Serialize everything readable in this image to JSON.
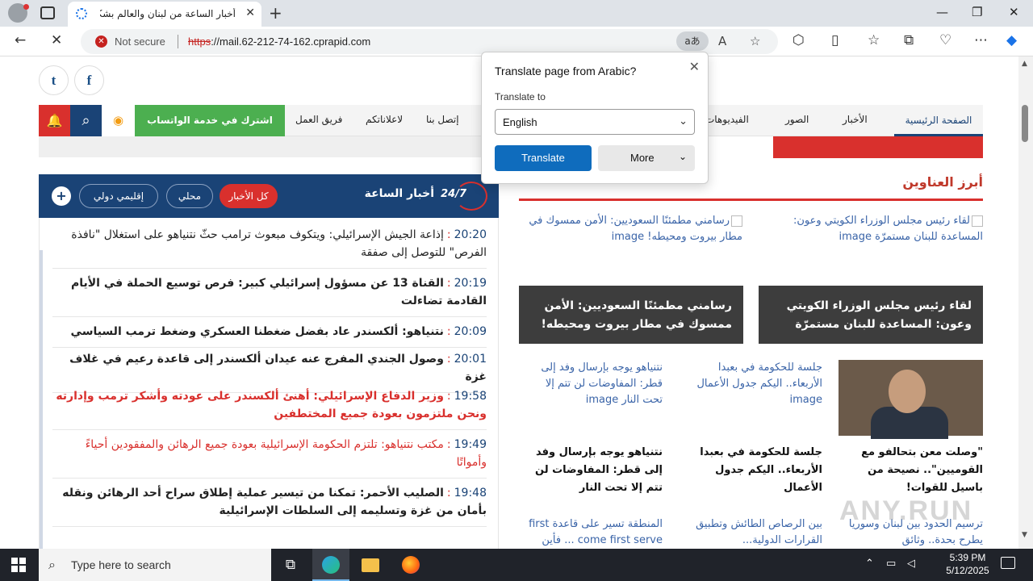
{
  "browser": {
    "tab_title": "أخبار الساعة من لبنان والعالم بشكل",
    "not_secure": "Not secure",
    "url_scheme": "https",
    "url_rest": "://mail.62-212-74-162.cprapid.com",
    "translate_icon": "aあ",
    "window_controls": [
      "—",
      "❐",
      "✕"
    ]
  },
  "translate_popup": {
    "title": "Translate page from Arabic?",
    "translate_to_label": "Translate to",
    "selected_language": "English",
    "translate_button": "Translate",
    "more_button": "More"
  },
  "site": {
    "social": [
      "t",
      "f"
    ],
    "nav": {
      "whatsapp": "اشترك في خدمة الواتساب",
      "items": [
        "فريق العمل",
        "لاعلاناتكم",
        "إتصل بنا",
        "الفيديوهات",
        "الصور",
        "الأخبار"
      ],
      "active": "الصفحة الرئيسية"
    },
    "live": {
      "title": "أخبار الساعة",
      "badge": "24/7",
      "filters": [
        "كل الأخبار",
        "محلي",
        "إقليمي دولي"
      ],
      "active_filter": "كل الأخبار"
    },
    "news": [
      {
        "time": "20:20",
        "text": "إذاعة الجيش الإسرائيلي: ويتكوف مبعوث ترامب حثّ نتنياهو على استغلال \"نافذة الفرص\" للتوصل إلى صفقة",
        "style": "normal"
      },
      {
        "time": "20:19",
        "text": "القناة 13 عن مسؤول إسرائيلي كبير: فرص توسيع الحملة في الأيام القادمة تضاءلت",
        "style": "bold"
      },
      {
        "time": "20:09",
        "text": "نتنياهو: ألكسندر عاد بفضل ضغطنا العسكري وضغط ترمب السياسي",
        "style": "bold"
      },
      {
        "time": "20:01",
        "text": "وصول الجندي المفرج عنه عيدان ألكسندر إلى قاعدة رعيم في غلاف غزة",
        "style": "bold"
      },
      {
        "time": "19:58",
        "text": "وزير الدفاع الإسرائيلي: أهنئ ألكسندر على عودته وأشكر ترمب وإدارته ونحن ملتزمون بعودة جميع المختطفين",
        "style": "red-bold"
      },
      {
        "time": "19:49",
        "text": "مكتب نتنياهو: تلتزم الحكومة الإسرائيلية بعودة جميع الرهائن والمفقودين أحياءً وأمواتًا",
        "style": "red"
      },
      {
        "time": "19:48",
        "text": "الصليب الأحمر: تمكنا من تيسير عملية إطلاق سراح أحد الرهائن ونقله بأمان من غزة وتسليمه إلى السلطات الإسرائيلية",
        "style": "bold"
      }
    ],
    "headlines_title": "أبرز العناوين",
    "headlines": [
      {
        "alt": "لقاء رئيس مجلس الوزراء الكويتي وعون: المساعدة للبنان مستمرّة image",
        "overlay": "لقاء رئيس مجلس الوزراء الكويتي وعون: المساعدة للبنان مستمرّة"
      },
      {
        "alt": "رسامني مطمئنًا السعوديين: الأمن ممسوك في مطار بيروت ومحيطه! image",
        "overlay": "رسامني مطمئنًا السعوديين: الأمن ممسوك في مطار بيروت ومحيطه!"
      }
    ],
    "small_cards": [
      {
        "alt": "",
        "title": "\"وصلت معن بتحالفو مع القوميين\".. نصيحة من باسيل للقوات!"
      },
      {
        "alt": "جلسة للحكومة في بعبدا الأربعاء.. اليكم جدول الأعمال image",
        "title": "جلسة للحكومة في بعبدا الأربعاء.. اليكم جدول الأعمال"
      },
      {
        "alt": "نتنياهو يوجه بإرسال وفد إلى قطر: المفاوضات لن تتم إلا تحت النار image",
        "title": "نتنياهو يوجه بإرسال وفد إلى قطر: المفاوضات لن تتم إلا تحت النار"
      }
    ],
    "bottom_alts": [
      "ترسيم الحدود بين لبنان وسوريا يطرح بحدة.. وثائق",
      "بين الرصاص الطائش وتطبيق القرارات الدولية...",
      "المنطقة تسير على قاعدة first come first serve ... فأين"
    ]
  },
  "watermark": "ANY.RUN",
  "taskbar": {
    "search_placeholder": "Type here to search",
    "time": "5:39 PM",
    "date": "5/12/2025"
  },
  "colors": {
    "brand_navy": "#1a4376",
    "brand_red": "#d9302d",
    "whatsapp_green": "#4caf50",
    "edge_blue": "#0f6cbd"
  }
}
